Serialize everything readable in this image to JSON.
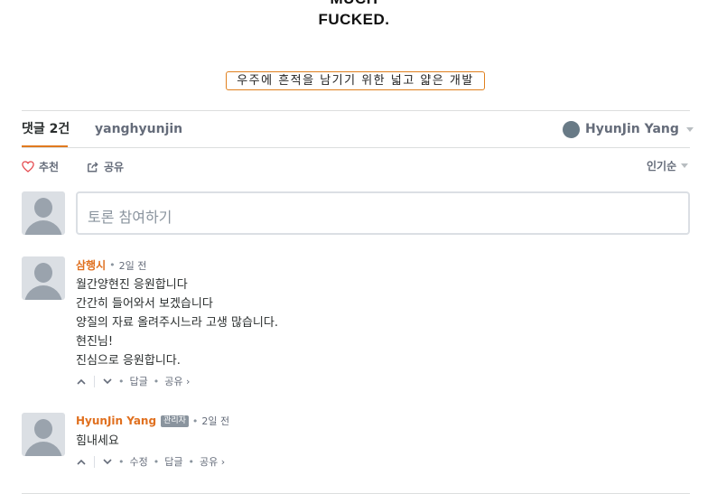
{
  "banner": {
    "line1": "MUCH",
    "line2": "FUCKED."
  },
  "tag_label": "우주에 흔적을 남기기 위한 넓고 얇은 개발",
  "nav": {
    "comments_tab": "댓글 2건",
    "community_tab": "yanghyunjin",
    "user_name": "HyunJin Yang"
  },
  "actions": {
    "recommend": "추천",
    "share": "공유",
    "sort": "인기순"
  },
  "compose_placeholder": "토론 참여하기",
  "comments": [
    {
      "author": "삼행시",
      "time": "2일 전",
      "lines": [
        "월간양현진 응원합니다",
        "간간히 들어와서 보겠습니다",
        "양질의 자료 올려주시느라 고생 많습니다.",
        "현진님!",
        "진심으로 응원합니다."
      ],
      "reply": "답글",
      "share": "공유 ›"
    },
    {
      "author": "HyunJin Yang",
      "badge": "관리자",
      "time": "2일 전",
      "lines": [
        "힘내세요"
      ],
      "edit": "수정",
      "reply": "답글",
      "share": "공유 ›"
    }
  ],
  "colors": {
    "accent": "#e0701f",
    "muted": "#656c7a",
    "border": "#dbdfe4"
  }
}
